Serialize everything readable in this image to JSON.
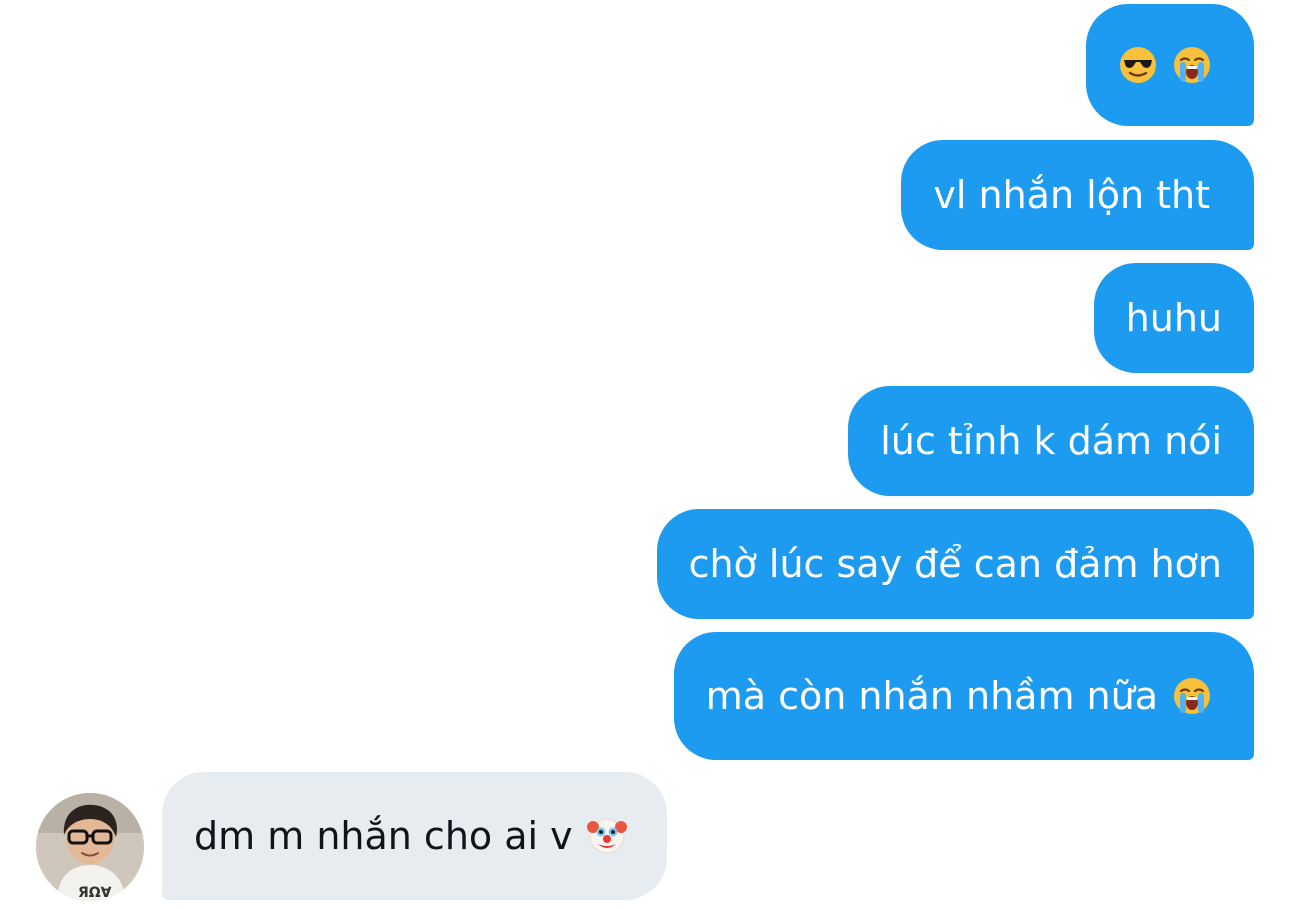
{
  "conversation": {
    "messages": [
      {
        "direction": "outgoing",
        "text": "",
        "emojis": [
          "smiling-face-with-sunglasses-icon",
          "loudly-crying-face-icon"
        ]
      },
      {
        "direction": "outgoing",
        "text": "vl nhắn lộn tht"
      },
      {
        "direction": "outgoing",
        "text": "huhu"
      },
      {
        "direction": "outgoing",
        "text": "lúc tỉnh k dám nói"
      },
      {
        "direction": "outgoing",
        "text": "chờ lúc say để can đảm hơn"
      },
      {
        "direction": "outgoing",
        "text": "mà còn nhắn nhầm nữa",
        "emojis": [
          "loudly-crying-face-icon"
        ]
      },
      {
        "direction": "incoming",
        "text": "dm m nhắn cho ai v",
        "emojis": [
          "clown-face-icon"
        ]
      }
    ]
  },
  "colors": {
    "outgoing_bubble": "#1d9bf0",
    "incoming_bubble": "#e7ecf0",
    "outgoing_text": "#ffffff",
    "incoming_text": "#0f1419",
    "background": "#ffffff"
  }
}
